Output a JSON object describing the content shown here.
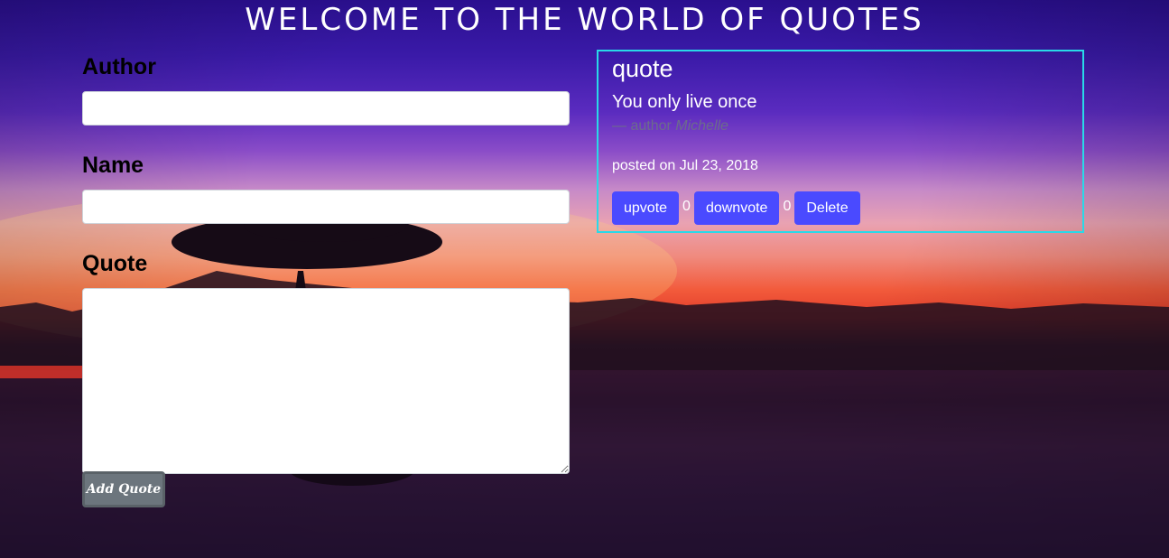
{
  "page": {
    "title": "Welcome to the World of Quotes"
  },
  "form": {
    "author_label": "Author",
    "author_value": "",
    "name_label": "Name",
    "name_value": "",
    "quote_label": "Quote",
    "quote_value": "",
    "submit_label": "Add Quote"
  },
  "quote_card": {
    "heading": "quote",
    "text": "You only live once",
    "author_prefix": "— author",
    "author_name": "Michelle",
    "posted_text": "posted on Jul 23, 2018",
    "upvote_label": "upvote",
    "upvote_count": "0",
    "downvote_label": "downvote",
    "downvote_count": "0",
    "delete_label": "Delete"
  },
  "colors": {
    "card_border": "#29d9e8",
    "action_button": "#4a4aff",
    "submit_button": "#6c757d"
  }
}
